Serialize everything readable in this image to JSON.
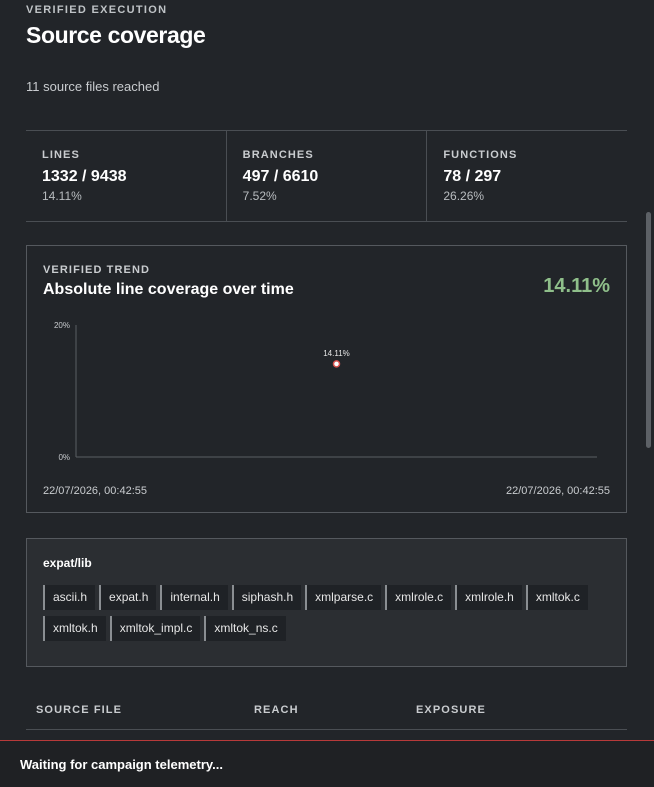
{
  "header": {
    "eyebrow": "VERIFIED EXECUTION",
    "title": "Source coverage",
    "subtitle": "11 source files reached"
  },
  "stats": [
    {
      "label": "LINES",
      "value": "1332 / 9438",
      "pct": "14.11%"
    },
    {
      "label": "BRANCHES",
      "value": "497 / 6610",
      "pct": "7.52%"
    },
    {
      "label": "FUNCTIONS",
      "value": "78 / 297",
      "pct": "26.26%"
    }
  ],
  "trend": {
    "eyebrow": "VERIFIED TREND",
    "title": "Absolute line coverage over time",
    "current_pct": "14.11%",
    "date_start": "22/07/2026, 00:42:55",
    "date_end": "22/07/2026, 00:42:55"
  },
  "chart_data": {
    "type": "scatter",
    "title": "Absolute line coverage over time",
    "xlabel": "",
    "ylabel": "",
    "y_tick_labels": [
      "20%",
      "0%"
    ],
    "ylim": [
      0,
      20
    ],
    "x": [
      "22/07/2026, 00:42:55"
    ],
    "series": [
      {
        "values": [
          14.11
        ],
        "labels": [
          "14.11%"
        ]
      }
    ],
    "point_color": "#d9534f",
    "grid": false
  },
  "lib": {
    "title": "expat/lib",
    "files": [
      "ascii.h",
      "expat.h",
      "internal.h",
      "siphash.h",
      "xmlparse.c",
      "xmlrole.c",
      "xmlrole.h",
      "xmltok.c",
      "xmltok.h",
      "xmltok_impl.c",
      "xmltok_ns.c"
    ]
  },
  "table": {
    "headers": [
      "SOURCE FILE",
      "REACH",
      "EXPOSURE"
    ]
  },
  "footer": {
    "status": "Waiting for campaign telemetry..."
  }
}
